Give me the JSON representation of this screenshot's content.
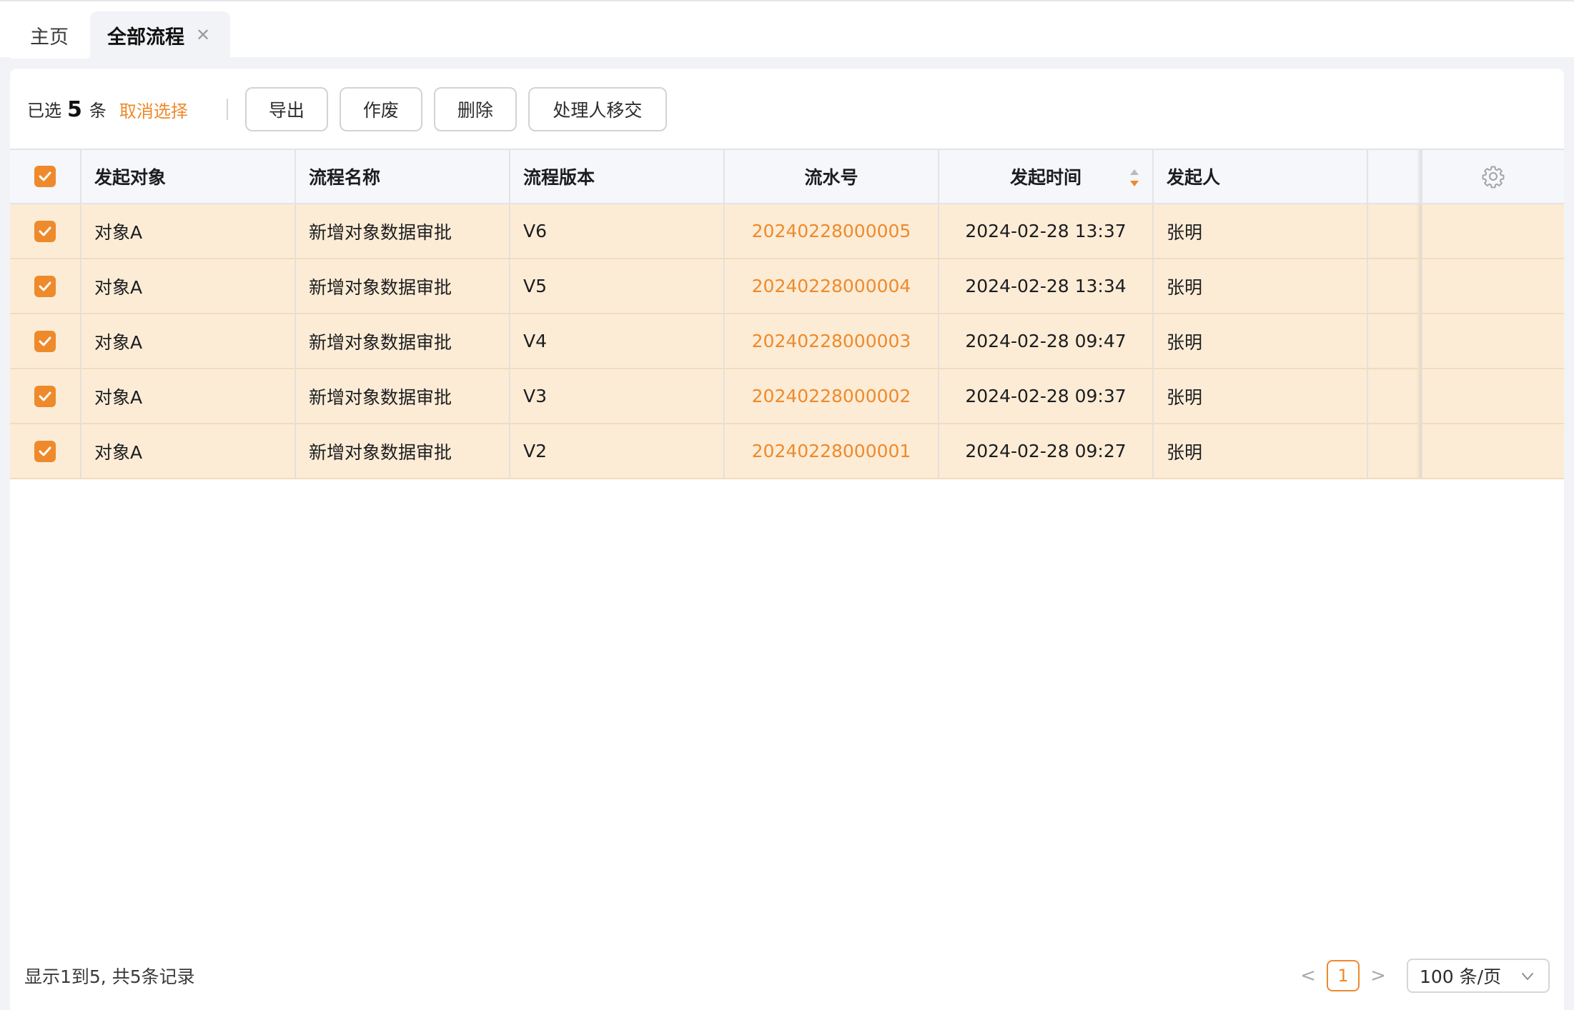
{
  "tabs": [
    {
      "label": "主页",
      "active": false
    },
    {
      "label": "全部流程",
      "active": true
    }
  ],
  "toolbar": {
    "selected_prefix": "已选",
    "selected_count": "5",
    "selected_suffix": "条",
    "cancel_selection": "取消选择",
    "buttons": {
      "export": "导出",
      "void": "作废",
      "delete": "删除",
      "transfer": "处理人移交"
    }
  },
  "table": {
    "columns": {
      "object": "发起对象",
      "name": "流程名称",
      "version": "流程版本",
      "serial": "流水号",
      "time": "发起时间",
      "initiator": "发起人"
    },
    "rows": [
      {
        "object": "对象A",
        "name": "新增对象数据审批",
        "version": "V6",
        "serial": "20240228000005",
        "time": "2024-02-28 13:37",
        "initiator": "张明"
      },
      {
        "object": "对象A",
        "name": "新增对象数据审批",
        "version": "V5",
        "serial": "20240228000004",
        "time": "2024-02-28 13:34",
        "initiator": "张明"
      },
      {
        "object": "对象A",
        "name": "新增对象数据审批",
        "version": "V4",
        "serial": "20240228000003",
        "time": "2024-02-28 09:47",
        "initiator": "张明"
      },
      {
        "object": "对象A",
        "name": "新增对象数据审批",
        "version": "V3",
        "serial": "20240228000002",
        "time": "2024-02-28 09:37",
        "initiator": "张明"
      },
      {
        "object": "对象A",
        "name": "新增对象数据审批",
        "version": "V2",
        "serial": "20240228000001",
        "time": "2024-02-28 09:27",
        "initiator": "张明"
      }
    ]
  },
  "footer": {
    "record_info": "显示1到5, 共5条记录",
    "current_page": "1",
    "page_size": "100 条/页"
  },
  "icons": {
    "tab_close": "close-icon",
    "sort": "sort-icon",
    "settings": "gear-icon",
    "prev": "chevron-left-icon",
    "next": "chevron-right-icon",
    "dropdown": "chevron-down-icon"
  },
  "colors": {
    "accent": "#ee8a2b",
    "selected_row": "#fcecd6",
    "header_bg": "#f6f7fa"
  }
}
